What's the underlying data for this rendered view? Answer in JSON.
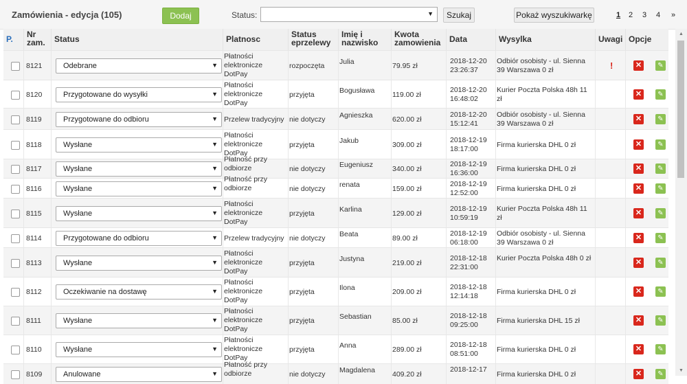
{
  "header": {
    "title": "Zamówienia - edycja (105)",
    "add_label": "Dodaj",
    "status_label": "Status:",
    "status_value": "",
    "search_label": "Szukaj",
    "show_search_label": "Pokaż wyszukiwarkę",
    "pages": [
      "1",
      "2",
      "3",
      "4"
    ],
    "current_page": "1",
    "next_label": "»"
  },
  "columns": {
    "select": "P.",
    "number": "Nr zam.",
    "status": "Status",
    "payment": "Platnosc",
    "transfer_status": "Status eprzelewy",
    "name": "Imię i nazwisko",
    "amount": "Kwota zamowienia",
    "date": "Data",
    "shipping": "Wysylka",
    "notes": "Uwagi",
    "options": "Opcje"
  },
  "colors": {
    "accent_green": "#8cc152",
    "delete_red": "#d9271c",
    "link_blue": "#2a6ebb"
  },
  "icons": {
    "delete": "close-icon",
    "edit": "edit-icon",
    "note": "exclamation-icon",
    "dropdown": "chevron-down-icon"
  },
  "orders": [
    {
      "id": "8121",
      "status": "Odebrane",
      "payment": "Płatności elektronicze DotPay",
      "transfer": "rozpoczęta",
      "name": "Julia",
      "amount": "79.95 zł",
      "date": "2018-12-20",
      "time": "23:26:37",
      "shipping": "Odbiór osobisty - ul. Sienna 39 Warszawa 0 zł",
      "note": "!"
    },
    {
      "id": "8120",
      "status": "Przygotowane do wysyłki",
      "payment": "Płatności elektronicze DotPay",
      "transfer": "przyjęta",
      "name": "Bogusława",
      "amount": "119.00 zł",
      "date": "2018-12-20",
      "time": "16:48:02",
      "shipping": "Kurier Poczta Polska 48h 11 zł",
      "note": ""
    },
    {
      "id": "8119",
      "status": "Przygotowane do odbioru",
      "payment": "Przelew tradycyjny",
      "transfer": "nie dotyczy",
      "name": "Agnieszka",
      "amount": "620.00 zł",
      "date": "2018-12-20",
      "time": "15:12:41",
      "shipping": "Odbiór osobisty - ul. Sienna 39 Warszawa 0 zł",
      "note": ""
    },
    {
      "id": "8118",
      "status": "Wysłane",
      "payment": "Płatności elektronicze DotPay",
      "transfer": "przyjęta",
      "name": "Jakub",
      "amount": "309.00 zł",
      "date": "2018-12-19",
      "time": "18:17:00",
      "shipping": "Firma kurierska DHL 0 zł",
      "note": ""
    },
    {
      "id": "8117",
      "status": "Wysłane",
      "payment": "Płatność przy odbiorze",
      "transfer": "nie dotyczy",
      "name": "Eugeniusz",
      "amount": "340.00 zł",
      "date": "2018-12-19",
      "time": "16:36:00",
      "shipping": "Firma kurierska DHL 0 zł",
      "note": ""
    },
    {
      "id": "8116",
      "status": "Wysłane",
      "payment": "Płatność przy odbiorze",
      "transfer": "nie dotyczy",
      "name": "renata",
      "amount": "159.00 zł",
      "date": "2018-12-19",
      "time": "12:52:00",
      "shipping": "Firma kurierska DHL 0 zł",
      "note": ""
    },
    {
      "id": "8115",
      "status": "Wysłane",
      "payment": "Płatności elektronicze DotPay",
      "transfer": "przyjęta",
      "name": "Karlina",
      "amount": "129.00 zł",
      "date": "2018-12-19",
      "time": "10:59:19",
      "shipping": "Kurier Poczta Polska 48h 11 zł",
      "note": ""
    },
    {
      "id": "8114",
      "status": "Przygotowane do odbioru",
      "payment": "Przelew tradycyjny",
      "transfer": "nie dotyczy",
      "name": "Beata",
      "amount": "89.00 zł",
      "date": "2018-12-19",
      "time": "06:18:00",
      "shipping": "Odbiór osobisty - ul. Sienna 39 Warszawa 0 zł",
      "note": ""
    },
    {
      "id": "8113",
      "status": "Wysłane",
      "payment": "Płatności elektronicze DotPay",
      "transfer": "przyjęta",
      "name": "Justyna",
      "amount": "219.00 zł",
      "date": "2018-12-18",
      "time": "22:31:00",
      "shipping": "Kurier Poczta Polska 48h 0 zł",
      "note": ""
    },
    {
      "id": "8112",
      "status": "Oczekiwanie na dostawę",
      "payment": "Płatności elektronicze DotPay",
      "transfer": "przyjęta",
      "name": "Ilona",
      "amount": "209.00 zł",
      "date": "2018-12-18",
      "time": "12:14:18",
      "shipping": "Firma kurierska DHL 0 zł",
      "note": ""
    },
    {
      "id": "8111",
      "status": "Wysłane",
      "payment": "Płatności elektronicze DotPay",
      "transfer": "przyjęta",
      "name": "Sebastian",
      "amount": "85.00 zł",
      "date": "2018-12-18",
      "time": "09:25:00",
      "shipping": "Firma kurierska DHL 15 zł",
      "note": ""
    },
    {
      "id": "8110",
      "status": "Wysłane",
      "payment": "Płatności elektronicze DotPay",
      "transfer": "przyjęta",
      "name": "Anna",
      "amount": "289.00 zł",
      "date": "2018-12-18",
      "time": "08:51:00",
      "shipping": "Firma kurierska DHL 0 zł",
      "note": ""
    },
    {
      "id": "8109",
      "status": "Anulowane",
      "payment": "Płatność przy odbiorze",
      "transfer": "nie dotyczy",
      "name": "Magdalena",
      "amount": "409.20 zł",
      "date": "2018-12-17",
      "time": "",
      "shipping": "Firma kurierska DHL 0 zł",
      "note": ""
    }
  ]
}
